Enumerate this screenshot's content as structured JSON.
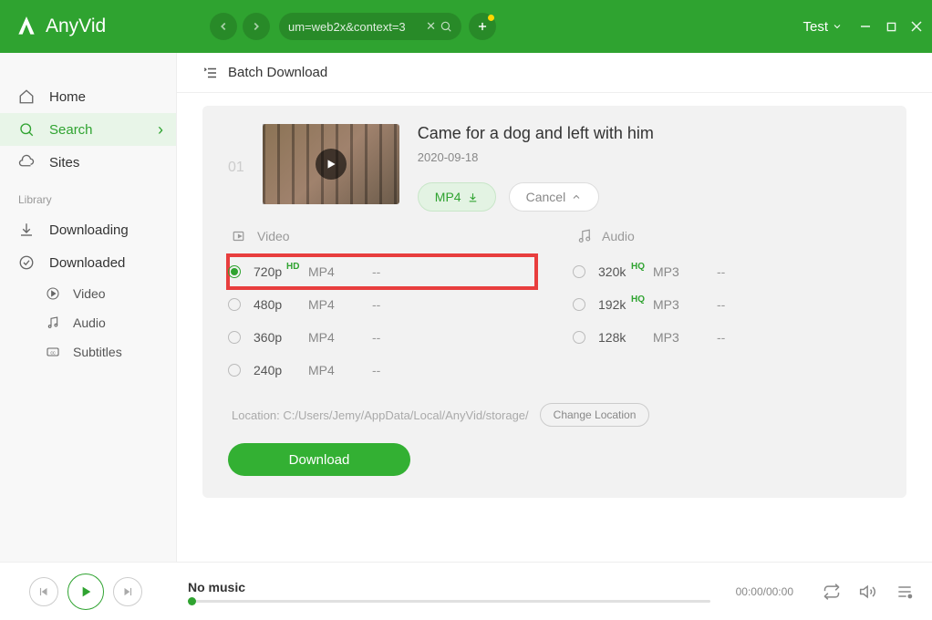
{
  "header": {
    "app_name": "AnyVid",
    "url_text": "um=web2x&context=3",
    "test_label": "Test"
  },
  "sidebar": {
    "items": [
      {
        "label": "Home"
      },
      {
        "label": "Search"
      },
      {
        "label": "Sites"
      }
    ],
    "library_label": "Library",
    "library_items": [
      {
        "label": "Downloading"
      },
      {
        "label": "Downloaded"
      }
    ],
    "sub_items": [
      {
        "label": "Video"
      },
      {
        "label": "Audio"
      },
      {
        "label": "Subtitles"
      }
    ]
  },
  "batch_label": "Batch Download",
  "card": {
    "index": "01",
    "title": "Came for a dog and left with him",
    "date": "2020-09-18",
    "mp4_label": "MP4",
    "cancel_label": "Cancel"
  },
  "options": {
    "video_label": "Video",
    "audio_label": "Audio",
    "video_opts": [
      {
        "res": "720p",
        "badge": "HD",
        "fmt": "MP4",
        "size": "--",
        "selected": true,
        "highlighted": true
      },
      {
        "res": "480p",
        "badge": "",
        "fmt": "MP4",
        "size": "--",
        "selected": false
      },
      {
        "res": "360p",
        "badge": "",
        "fmt": "MP4",
        "size": "--",
        "selected": false
      },
      {
        "res": "240p",
        "badge": "",
        "fmt": "MP4",
        "size": "--",
        "selected": false
      }
    ],
    "audio_opts": [
      {
        "res": "320k",
        "badge": "HQ",
        "fmt": "MP3",
        "size": "--",
        "selected": false
      },
      {
        "res": "192k",
        "badge": "HQ",
        "fmt": "MP3",
        "size": "--",
        "selected": false
      },
      {
        "res": "128k",
        "badge": "",
        "fmt": "MP3",
        "size": "--",
        "selected": false
      }
    ],
    "location_prefix": "Location: ",
    "location_path": "C:/Users/Jemy/AppData/Local/AnyVid/storage/",
    "change_location": "Change Location",
    "download": "Download"
  },
  "player": {
    "title": "No music",
    "time": "00:00/00:00"
  }
}
